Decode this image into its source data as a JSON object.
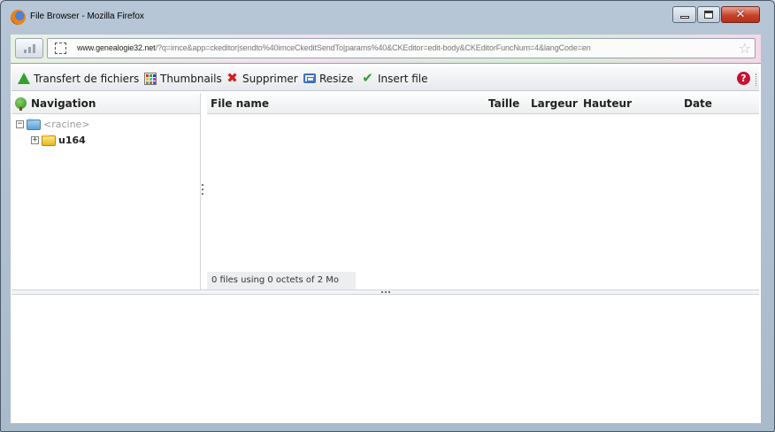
{
  "window": {
    "title": "File Browser - Mozilla Firefox",
    "close_glyph": "✕"
  },
  "address": {
    "domain": "www.genealogie32.net",
    "path": "/?q=imce&app=ckeditor|sendto%40imceCkeditSendTo|params%40&CKEditor=edit-body&CKEditorFuncNum=4&langCode=en",
    "star_glyph": "☆"
  },
  "toolbar": {
    "upload_label": "Transfert de fichiers",
    "thumbnails_label": "Thumbnails",
    "delete_label": "Supprimer",
    "resize_label": "Resize",
    "insert_label": "Insert file",
    "help_glyph": "?",
    "delete_glyph": "✖",
    "insert_glyph": "✔"
  },
  "navigation": {
    "title": "Navigation",
    "root_label": "<racine>",
    "root_expander": "−",
    "folder_label": "u164",
    "folder_expander": "+"
  },
  "file_list": {
    "columns": [
      "File name",
      "Taille",
      "Largeur",
      "Hauteur",
      "Date"
    ],
    "status": "0 files using 0 octets of 2 Mo"
  },
  "colors": {
    "accent_green": "#35a12b",
    "delete_red": "#d0211b",
    "close_button": "#c7422a"
  }
}
